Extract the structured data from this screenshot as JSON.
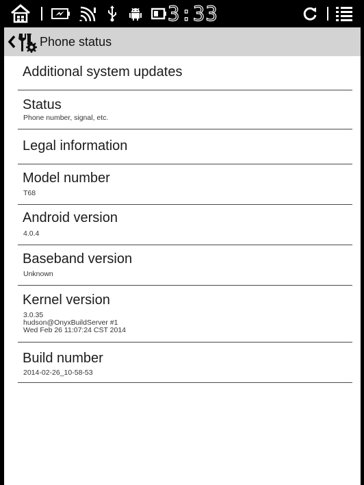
{
  "status_bar": {
    "time": "3:33",
    "icons": [
      "home-icon",
      "battery-charging-icon",
      "wifi-signal-icon",
      "usb-icon",
      "android-icon",
      "battery-icon",
      "refresh-icon",
      "menu-list-icon"
    ]
  },
  "action_bar": {
    "title": "Phone status",
    "back_icon": "chevron-left-icon",
    "app_icon": "settings-tools-icon"
  },
  "items": [
    {
      "title": "Additional system updates"
    },
    {
      "title": "Status",
      "summary": "Phone number, signal, etc."
    },
    {
      "title": "Legal information"
    },
    {
      "title": "Model number",
      "summary": "T68"
    },
    {
      "title": "Android version",
      "summary": "4.0.4"
    },
    {
      "title": "Baseband version",
      "summary": "Unknown"
    },
    {
      "title": "Kernel version",
      "summary": "3.0.35\nhudson@OnyxBuildServer #1\nWed Feb 26 11:07:24 CST 2014"
    },
    {
      "title": "Build number",
      "summary": "2014-02-26_10-58-53"
    }
  ]
}
